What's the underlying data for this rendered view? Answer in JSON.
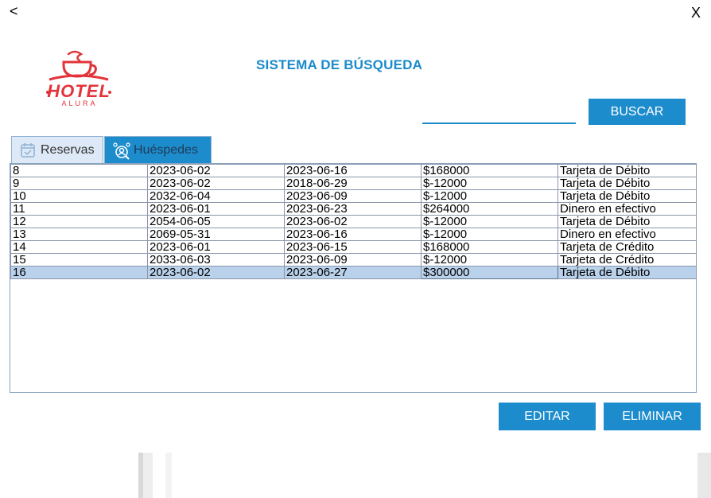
{
  "nav": {
    "back_label": "<",
    "close_label": "X"
  },
  "logo": {
    "text_main": "HOTEL",
    "text_sub": "ALURA",
    "color": "#e2333a"
  },
  "header": {
    "title": "SISTEMA DE BÚSQUEDA"
  },
  "search": {
    "value": "",
    "button_label": "BUSCAR"
  },
  "tabs": [
    {
      "label": "Reservas",
      "icon": "calendar-check-icon",
      "selected": true
    },
    {
      "label": "Huéspedes",
      "icon": "guests-search-icon",
      "selected": false
    }
  ],
  "table": {
    "rows": [
      [
        "8",
        "2023-06-02",
        "2023-06-16",
        "$168000",
        "Tarjeta de Débito"
      ],
      [
        "9",
        "2023-06-02",
        "2018-06-29",
        "$-12000",
        "Tarjeta de Débito"
      ],
      [
        "10",
        "2032-06-04",
        "2023-06-09",
        "$-12000",
        "Tarjeta de Débito"
      ],
      [
        "11",
        "2023-06-01",
        "2023-06-23",
        "$264000",
        "Dinero en efectivo"
      ],
      [
        "12",
        "2054-06-05",
        "2023-06-02",
        "$-12000",
        "Tarjeta de Débito"
      ],
      [
        "13",
        "2069-05-31",
        "2023-06-16",
        "$-12000",
        "Dinero en efectivo"
      ],
      [
        "14",
        "2023-06-01",
        "2023-06-15",
        "$168000",
        "Tarjeta de Crédito"
      ],
      [
        "15",
        "2033-06-03",
        "2023-06-09",
        "$-12000",
        "Tarjeta de Crédito"
      ],
      [
        "16",
        "2023-06-02",
        "2023-06-27",
        "$300000",
        "Tarjeta de Débito"
      ]
    ],
    "selected_row": 8
  },
  "actions": {
    "edit_label": "EDITAR",
    "delete_label": "ELIMINAR"
  },
  "colors": {
    "accent": "#1d8ccc",
    "selection": "#b9d1ea",
    "title": "#1a8acb"
  }
}
